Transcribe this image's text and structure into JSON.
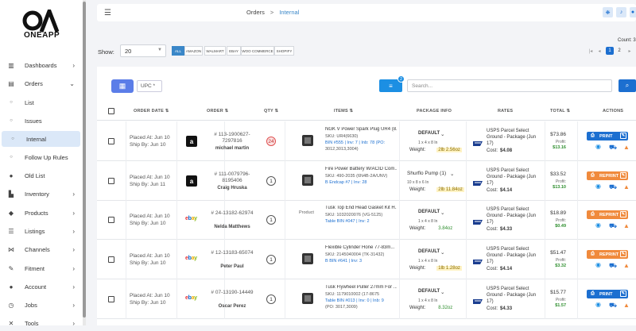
{
  "app": {
    "logo_text": "ONEAPP"
  },
  "sidebar": {
    "items": [
      {
        "label": "Dashboards",
        "icon": "chart-bars-icon",
        "chevron": "›"
      },
      {
        "label": "Orders",
        "icon": "box-icon",
        "chevron": "⌄"
      },
      {
        "label": "List",
        "icon": "circle-icon"
      },
      {
        "label": "Issues",
        "icon": "circle-icon"
      },
      {
        "label": "Internal",
        "icon": "circle-icon"
      },
      {
        "label": "Follow Up Rules",
        "icon": "circle-icon"
      },
      {
        "label": "Old List",
        "icon": "info-icon"
      },
      {
        "label": "Inventory",
        "icon": "warehouse-icon",
        "chevron": "›"
      },
      {
        "label": "Products",
        "icon": "tag-icon",
        "chevron": "›"
      },
      {
        "label": "Listings",
        "icon": "list-icon",
        "chevron": "›"
      },
      {
        "label": "Channels",
        "icon": "share-icon",
        "chevron": "›"
      },
      {
        "label": "Fitment",
        "icon": "wrench-icon",
        "chevron": "›"
      },
      {
        "label": "Account",
        "icon": "user-icon",
        "chevron": "›"
      },
      {
        "label": "Jobs",
        "icon": "clock-icon",
        "chevron": "›"
      },
      {
        "label": "Tools",
        "icon": "tools-icon",
        "chevron": "›"
      }
    ]
  },
  "header": {
    "breadcrumb": [
      "Orders",
      "Internal"
    ],
    "separator": ">",
    "hamburger": "☰"
  },
  "toolbar": {
    "show_label": "Show:",
    "show_value": "20",
    "marketplaces": [
      "ALL",
      "AMAZON",
      "WALMART",
      "EBAY",
      "WOO COMMERCE",
      "SHOPIFY"
    ],
    "count_label": "Count: 3",
    "pages": [
      "1",
      "2"
    ],
    "upc_label": "UPC *",
    "filter_badge": "2",
    "search_placeholder": "Search..."
  },
  "table": {
    "headers": [
      "ORDER DATE",
      "ORDER",
      "QTY",
      "ITEMS",
      "PACKAGE INFO",
      "RATES",
      "TOTAL",
      "ACTIONS"
    ],
    "rows": [
      {
        "placed": "Placed At: Jun 10",
        "ship": "Ship By: Jun 10",
        "channel": "amazon",
        "order_no": "# 113-1900627-7297816",
        "customer": "michael martin",
        "qty": "24",
        "qty_alert": true,
        "title": "NGK V Power Spark Plug UR4 (8...",
        "sku": "SKU: UR4(6630)",
        "sku_paren": "(6630)",
        "bin_line": "BIN #555 | Inv: 7 | Inb: 78 (PO:",
        "bin_line2": "3012,3013,3004)",
        "pkg": "DEFAULT",
        "pkg_bold": true,
        "dims": "1 x 4 x 8 In",
        "weight": "2lb 2.56oz",
        "weight_style": "y",
        "carrier": "USPS Parcel Select Ground - Package (Jun 17)",
        "cost": "$4.08",
        "total": "$73.86",
        "profit": "$13.16",
        "action": "PRINT"
      },
      {
        "placed": "Placed At: Jun 10",
        "ship": "Ship By: Jun 11",
        "channel": "amazon",
        "order_no": "# 111-0079796-8195406",
        "customer": "Craig Hruska",
        "qty": "1",
        "qty_alert": false,
        "title": "Fire Power Battery W/ACID Com...",
        "sku": "SKU: 490-2035 (6N4B-2A/UNV)",
        "sku_paren": "",
        "bin_line": "B Endcap #7 | Inv: 28",
        "bin_line2": "",
        "pkg": "Shurflo Pump (1)",
        "pkg_bold": false,
        "dims": "10 x 8 x 6 In",
        "weight": "2lb 11.84oz",
        "weight_style": "y",
        "carrier": "USPS Parcel Select Ground - Package (Jun 17)",
        "cost": "$4.14",
        "total": "$33.52",
        "profit": "$13.10",
        "action": "REPRINT"
      },
      {
        "placed": "Placed At: Jun 10",
        "ship": "Ship By: Jun 10",
        "channel": "ebay",
        "order_no": "# 24-13182-62974",
        "customer": "Nelda Matthews",
        "qty": "1",
        "qty_alert": false,
        "title": "Tusk Top End Head Gasket Kit H...",
        "sku": "SKU: 1032020076 (VG-5125)",
        "sku_paren": "",
        "bin_line": "Table BIN #047 | Inv: 2",
        "bin_line2": "",
        "pkg": "DEFAULT",
        "pkg_bold": true,
        "dims": "1 x 4 x 8 In",
        "weight": "3.84oz",
        "weight_style": "g",
        "carrier": "USPS Parcel Select Ground - Package (Jun 17)",
        "cost": "$4.33",
        "total": "$18.89",
        "profit": "$0.49",
        "action": "REPRINT",
        "img_alt": "Product"
      },
      {
        "placed": "Placed At: Jun 10",
        "ship": "Ship By: Jun 10",
        "channel": "ebay",
        "order_no": "# 12-13183-65074",
        "customer": "Peter Paul",
        "qty": "1",
        "qty_alert": false,
        "title": "Flexible Cylinder Hone 77-83m...",
        "sku": "SKU: 2145040004 (TK-31432)",
        "sku_paren": "",
        "bin_line": "B BIN #641 | Inv: 3",
        "bin_line2": "",
        "pkg": "DEFAULT",
        "pkg_bold": true,
        "dims": "1 x 4 x 8 In",
        "weight": "1lb 1.28oz",
        "weight_style": "y",
        "carrier": "USPS Parcel Select Ground - Package (Jun 17)",
        "cost": "$4.14",
        "total": "$51.47",
        "profit": "$3.32",
        "action": "REPRINT"
      },
      {
        "placed": "Placed At: Jun 10",
        "ship": "Ship By: Jun 10",
        "channel": "ebay",
        "order_no": "# 07-13190-14449",
        "customer": "Oscar Perez",
        "qty": "1",
        "qty_alert": false,
        "title": "Tusk Flywheel Puller 27mm For ...",
        "sku": "SKU: 1179010002 (17-8675",
        "sku_paren": "CR005)",
        "bin_line": "Table BIN #013 | Inv: 0 | Inb: 9",
        "bin_line2": "(PO: 3017,3009)",
        "pkg": "DEFAULT",
        "pkg_bold": true,
        "dims": "1 x 4 x 8 In",
        "weight": "8.32oz",
        "weight_style": "g",
        "carrier": "USPS Parcel Select Ground - Package (Jun 17)",
        "cost": "$4.33",
        "total": "$15.77",
        "profit": "$1.57",
        "action": "PRINT"
      }
    ],
    "profit_label": "Profit:",
    "cost_label": "Cost:",
    "weight_label": "Weight:"
  }
}
